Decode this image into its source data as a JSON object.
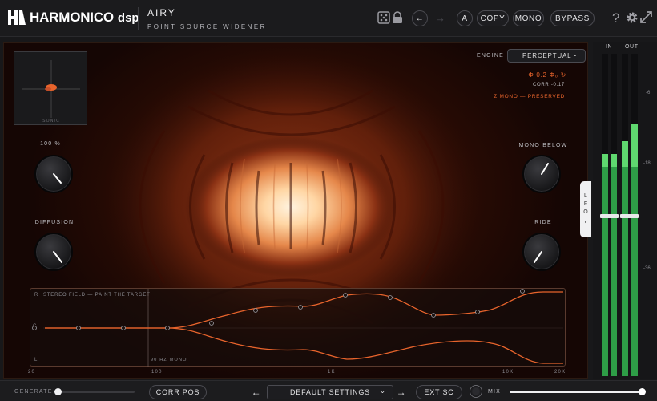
{
  "brand": {
    "name": "HARMONICO",
    "sub": "dsp"
  },
  "plugin": {
    "title": "AIRY",
    "subtitle": "POINT SOURCE WIDENER"
  },
  "header": {
    "a_label": "A",
    "copy_label": "COPY",
    "mono_label": "MONO",
    "bypass_label": "BYPASS",
    "help_label": "?"
  },
  "engine": {
    "label": "ENGINE",
    "value": "PERCEPTUAL"
  },
  "status": {
    "phase": "Φ 0.2 Φ₀ ↻",
    "corr": "CORR -0.17",
    "mono": "Σ MONO — PRESERVED"
  },
  "radar": {
    "label": "SONIC"
  },
  "knobs": {
    "width_label": "100 %",
    "diffusion_label": "DIFFUSION",
    "monobelow_label": "MONO BELOW",
    "ride_label": "RIDE"
  },
  "field": {
    "title": "STEREO FIELD — PAINT THE TARGET",
    "mono_note": "90 HZ MONO",
    "r": "R",
    "c": "C",
    "l": "L",
    "ticks": [
      "20",
      "100",
      "1K",
      "10K",
      "20K"
    ]
  },
  "lfo": {
    "label": "LFO"
  },
  "meters": {
    "in": "IN",
    "out": "OUT",
    "scale": [
      "-6",
      "-18",
      "-36"
    ],
    "in_levels": [
      0.69,
      0.69
    ],
    "out_levels": [
      0.73,
      0.78
    ]
  },
  "footer": {
    "generate": "GENERATE",
    "corr_pos": "CORR POS",
    "preset": "DEFAULT SETTINGS",
    "ext_sc": "EXT SC",
    "mix": "MIX",
    "mix_value": 1.0
  },
  "colors": {
    "accent": "#e8642c",
    "meter": "#2e9d47",
    "meter_hot": "#5fd86f"
  }
}
